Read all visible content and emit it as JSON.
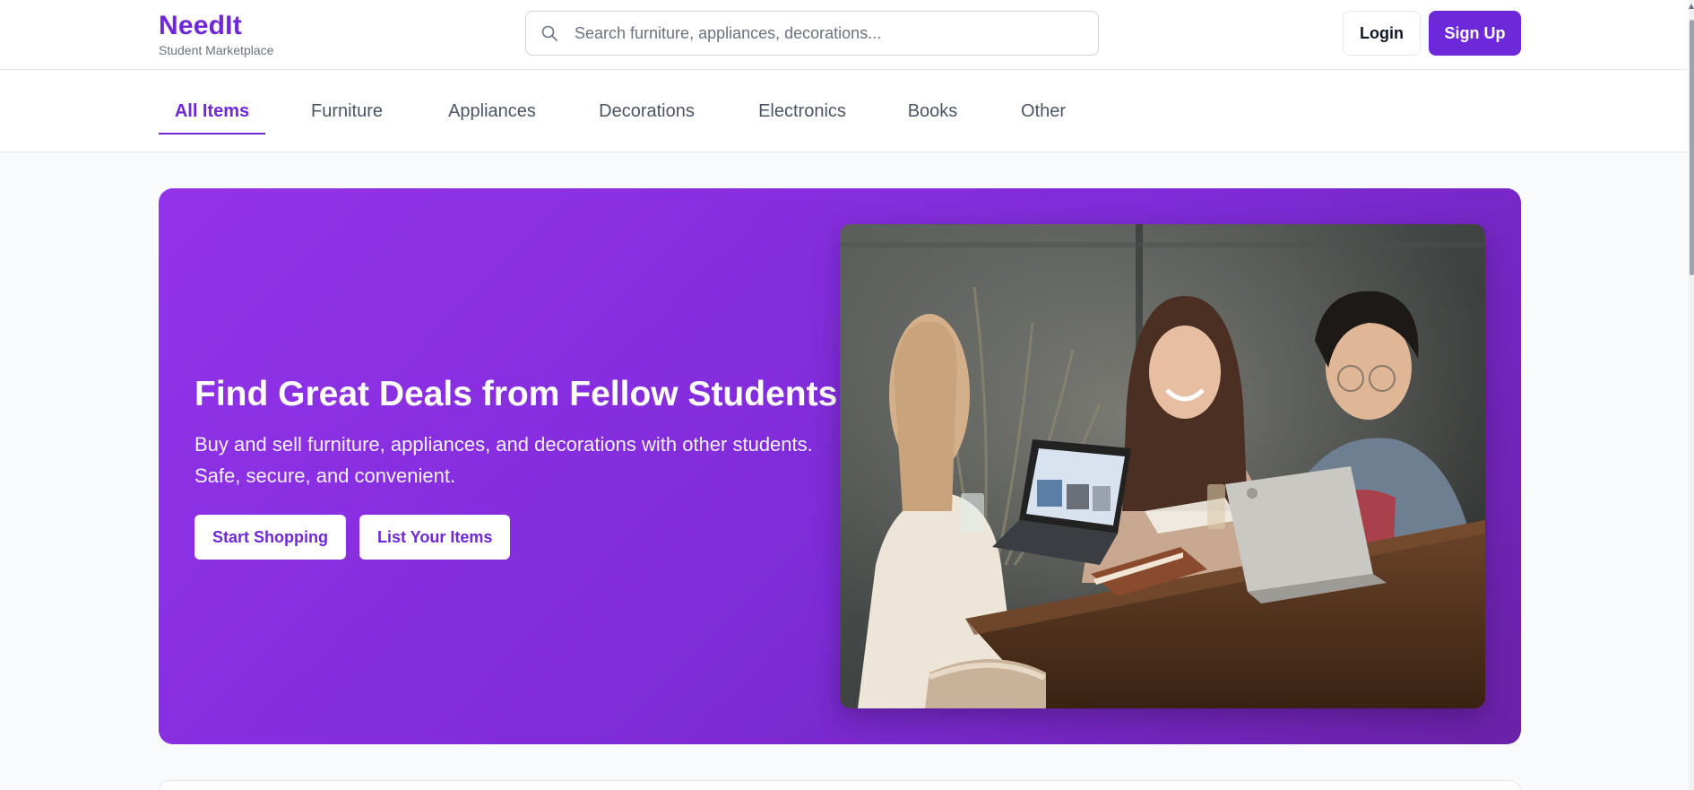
{
  "header": {
    "brand_name": "NeedIt",
    "brand_tagline": "Student Marketplace",
    "search_placeholder": "Search furniture, appliances, decorations...",
    "search_icon": "search-icon",
    "login_label": "Login",
    "signup_label": "Sign Up"
  },
  "categories": {
    "items": [
      {
        "label": "All Items",
        "active": true
      },
      {
        "label": "Furniture",
        "active": false
      },
      {
        "label": "Appliances",
        "active": false
      },
      {
        "label": "Decorations",
        "active": false
      },
      {
        "label": "Electronics",
        "active": false
      },
      {
        "label": "Books",
        "active": false
      },
      {
        "label": "Other",
        "active": false
      }
    ]
  },
  "hero": {
    "title": "Find Great Deals from Fellow Students!",
    "subtitle_line1": "Buy and sell furniture, appliances, and decorations with other students.",
    "subtitle_line2": "Safe, secure, and convenient.",
    "primary_button": "Start Shopping",
    "secondary_button": "List Your Items"
  },
  "colors": {
    "brand": "#6d28d9",
    "hero_gradient_start": "#9333ea",
    "hero_gradient_end": "#6b21a8",
    "page_background": "#f8fafc"
  }
}
